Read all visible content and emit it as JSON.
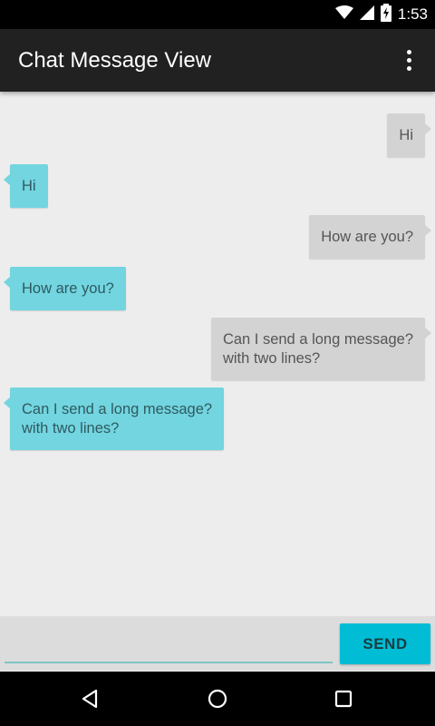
{
  "status_bar": {
    "time": "1:53",
    "icons": [
      "wifi-icon",
      "signal-icon",
      "battery-charging-icon"
    ]
  },
  "app_bar": {
    "title": "Chat Message View",
    "overflow_icon": "more-vert-icon"
  },
  "messages": [
    {
      "direction": "outgoing",
      "text": "Hi"
    },
    {
      "direction": "incoming",
      "text": "Hi"
    },
    {
      "direction": "outgoing",
      "text": "How are you?"
    },
    {
      "direction": "incoming",
      "text": "How are you?"
    },
    {
      "direction": "outgoing",
      "text": "Can I send a long message?\nwith two lines?"
    },
    {
      "direction": "incoming",
      "text": "Can I send a long message?\nwith two lines?"
    }
  ],
  "composer": {
    "input_value": "",
    "send_label": "SEND"
  },
  "nav_bar": {
    "icons": [
      "back-icon",
      "home-icon",
      "recents-icon"
    ]
  },
  "colors": {
    "app_bar": "#212121",
    "outgoing_bubble": "#d3d3d3",
    "incoming_bubble": "#72d5e0",
    "send_button": "#00bcd4",
    "background": "#ededed"
  }
}
